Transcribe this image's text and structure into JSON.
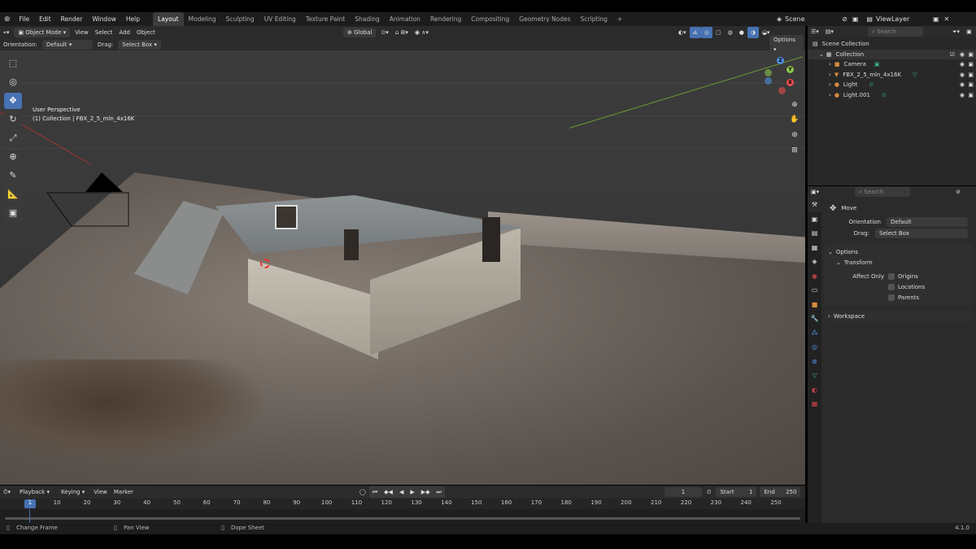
{
  "menu": [
    "File",
    "Edit",
    "Render",
    "Window",
    "Help"
  ],
  "workspaces": [
    "Layout",
    "Modeling",
    "Sculpting",
    "UV Editing",
    "Texture Paint",
    "Shading",
    "Animation",
    "Rendering",
    "Compositing",
    "Geometry Nodes",
    "Scripting"
  ],
  "active_workspace": "Layout",
  "scene": {
    "label": "Scene",
    "view_layer": "ViewLayer"
  },
  "viewport_header": {
    "mode": "Object Mode",
    "menus": [
      "View",
      "Select",
      "Add",
      "Object"
    ],
    "transform": "Global",
    "orientation_label": "Orientation:",
    "orientation_value": "Default",
    "drag_label": "Drag:",
    "drag_value": "Select Box",
    "options": "Options"
  },
  "viewport_overlay": {
    "line1": "User Perspective",
    "line2": "(1) Collection | FBX_2_5_mln_4x16K"
  },
  "gizmo": {
    "z": "Z",
    "y": "Y",
    "x": "X"
  },
  "outliner": {
    "search_placeholder": "Search",
    "items": [
      {
        "label": "Scene Collection"
      },
      {
        "label": "Collection"
      },
      {
        "label": "Camera"
      },
      {
        "label": "FBX_2_5_mln_4x16K"
      },
      {
        "label": "Light"
      },
      {
        "label": "Light.001"
      }
    ]
  },
  "properties": {
    "search_placeholder": "Search",
    "tool_name": "Move",
    "orientation_label": "Orientation",
    "orientation_value": "Default",
    "drag_label": "Drag:",
    "drag_value": "Select Box",
    "options_label": "Options",
    "transform_label": "Transform",
    "affect_only_label": "Affect Only",
    "affect": [
      "Origins",
      "Locations",
      "Parents"
    ],
    "workspace_label": "Workspace"
  },
  "timeline": {
    "menus": [
      "Playback",
      "Keying",
      "View",
      "Marker"
    ],
    "current_frame": "1",
    "start_label": "Start",
    "start": "1",
    "end_label": "End",
    "end": "250",
    "ticks": [
      "1",
      "10",
      "20",
      "30",
      "40",
      "50",
      "60",
      "70",
      "80",
      "90",
      "100",
      "110",
      "120",
      "130",
      "140",
      "150",
      "160",
      "170",
      "180",
      "190",
      "200",
      "210",
      "220",
      "230",
      "240",
      "250"
    ]
  },
  "statusbar": {
    "left": "Change Frame",
    "middle": "Pan View",
    "right": "Dope Sheet",
    "version": "4.1.0"
  },
  "colors": {
    "accent": "#4772b3",
    "x_axis": "#e44d4d",
    "y_axis": "#8bc34a",
    "z_axis": "#4e8fe0"
  }
}
